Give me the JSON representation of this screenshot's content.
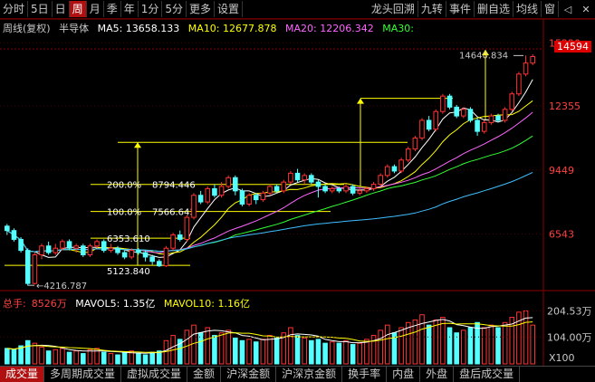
{
  "toolbar": {
    "items": [
      "分时",
      "5日",
      "日",
      "周",
      "月",
      "季",
      "年",
      "1分",
      "5分",
      "更多",
      "设置"
    ],
    "active": "周",
    "right_items": [
      "龙头回溯",
      "九转",
      "事件",
      "删自选",
      "均线",
      "窗"
    ]
  },
  "legend": {
    "title": "周线(复权)",
    "name": "半导体",
    "ma5": "MA5: 13658.133",
    "ma10": "MA10: 12677.878",
    "ma20": "MA20: 12206.342",
    "ma30": "MA30: ",
    "colors": {
      "ma5": "#ffffff",
      "ma10": "#ffff00",
      "ma20": "#ff66ff",
      "ma30": "#33ff33",
      "ma60": "#3fbfff"
    }
  },
  "price_axis": {
    "ticks": [
      "15220",
      "12355",
      "9449",
      "6543"
    ],
    "current": "14594"
  },
  "annotations": {
    "high": "14640.834",
    "low": "4216.787",
    "level200": "200.0%",
    "level200_val": "8794.446",
    "level100": "100.0%",
    "level100_val": "7566.643",
    "level_mid_val": "6353.610",
    "level_base_val": "5123.840"
  },
  "volume": {
    "label": "总手:",
    "value": "8526万",
    "mavol5": "MAVOL5: 1.35亿",
    "mavol10": "MAVOL10: 1.16亿",
    "axis_ticks": [
      "204.53万",
      "104.00万"
    ],
    "unit": "X100"
  },
  "bottom_tabs": [
    "成交量",
    "多周期成交量",
    "虚拟成交量",
    "金额",
    "沪深金额",
    "沪深京金额",
    "换手率",
    "内盘",
    "外盘",
    "盘后成交量"
  ],
  "bottom_active": "成交量",
  "chart_data": {
    "type": "candlestick",
    "y_range": [
      4100,
      15600
    ],
    "candles": [
      [
        6900,
        6700,
        7000,
        6500
      ],
      [
        6700,
        6300,
        6800,
        6200
      ],
      [
        6300,
        5800,
        6400,
        5700
      ],
      [
        5800,
        4300,
        5900,
        4200
      ],
      [
        4300,
        5600,
        5700,
        4250
      ],
      [
        5600,
        6000,
        6100,
        5400
      ],
      [
        6000,
        5700,
        6200,
        5600
      ],
      [
        5700,
        5900,
        6100,
        5600
      ],
      [
        5900,
        6200,
        6300,
        5800
      ],
      [
        6200,
        5900,
        6300,
        5800
      ],
      [
        5900,
        6000,
        6100,
        5700
      ],
      [
        6000,
        5600,
        6100,
        5500
      ],
      [
        5600,
        6000,
        6100,
        5500
      ],
      [
        6000,
        6200,
        6300,
        5900
      ],
      [
        6200,
        5800,
        6300,
        5700
      ],
      [
        5800,
        5900,
        6100,
        5700
      ],
      [
        5900,
        5700,
        6000,
        5600
      ],
      [
        5700,
        5500,
        5800,
        5400
      ],
      [
        5500,
        5800,
        5900,
        5400
      ],
      [
        5800,
        5700,
        5900,
        5600
      ],
      [
        5700,
        5500,
        5800,
        5300
      ],
      [
        5500,
        5300,
        5600,
        5150
      ],
      [
        5300,
        5100,
        5400,
        5050
      ],
      [
        5100,
        5900,
        6000,
        5050
      ],
      [
        5900,
        6500,
        6600,
        5800
      ],
      [
        6500,
        6300,
        6700,
        6200
      ],
      [
        6300,
        7300,
        7400,
        6200
      ],
      [
        7300,
        8300,
        8400,
        7200
      ],
      [
        8300,
        8000,
        8500,
        7900
      ],
      [
        8000,
        8600,
        8700,
        7900
      ],
      [
        8600,
        8300,
        8800,
        8200
      ],
      [
        8300,
        8700,
        8900,
        8200
      ],
      [
        8700,
        9100,
        9200,
        8600
      ],
      [
        9100,
        8500,
        9200,
        8300
      ],
      [
        8500,
        7900,
        8600,
        7800
      ],
      [
        7900,
        8300,
        8400,
        7800
      ],
      [
        8300,
        8100,
        8400,
        7900
      ],
      [
        8100,
        8400,
        8500,
        8000
      ],
      [
        8400,
        8700,
        8800,
        8300
      ],
      [
        8700,
        8500,
        8800,
        8400
      ],
      [
        8500,
        8900,
        9000,
        8400
      ],
      [
        8900,
        9300,
        9400,
        8800
      ],
      [
        9300,
        9000,
        9500,
        8900
      ],
      [
        9000,
        9200,
        9300,
        8800
      ],
      [
        9200,
        8900,
        9300,
        8800
      ],
      [
        8900,
        8700,
        9000,
        8200
      ],
      [
        8700,
        8500,
        8800,
        8400
      ],
      [
        8500,
        8600,
        8700,
        8400
      ],
      [
        8600,
        8500,
        8700,
        8400
      ],
      [
        8500,
        8700,
        8800,
        8400
      ],
      [
        8700,
        8400,
        8800,
        8300
      ],
      [
        8400,
        8500,
        8600,
        8300
      ],
      [
        8500,
        8600,
        8700,
        8400
      ],
      [
        8600,
        8800,
        8900,
        8500
      ],
      [
        8800,
        9200,
        9300,
        8700
      ],
      [
        9200,
        9600,
        9700,
        9100
      ],
      [
        9600,
        9400,
        9700,
        9300
      ],
      [
        9400,
        9900,
        10000,
        9300
      ],
      [
        9900,
        10400,
        10500,
        9800
      ],
      [
        10400,
        10900,
        11000,
        10300
      ],
      [
        10900,
        11700,
        11800,
        10800
      ],
      [
        11700,
        11300,
        11900,
        11200
      ],
      [
        11300,
        12100,
        12200,
        11200
      ],
      [
        12100,
        12800,
        12900,
        12000
      ],
      [
        12800,
        12300,
        12900,
        12200
      ],
      [
        12300,
        11900,
        12400,
        11800
      ],
      [
        11900,
        12200,
        12300,
        11800
      ],
      [
        12200,
        11700,
        12300,
        11600
      ],
      [
        11700,
        11200,
        11800,
        11000
      ],
      [
        11200,
        11600,
        11700,
        11100
      ],
      [
        11600,
        11900,
        12000,
        11500
      ],
      [
        11900,
        11700,
        12000,
        11600
      ],
      [
        11700,
        12200,
        12300,
        11600
      ],
      [
        12200,
        12900,
        13000,
        12100
      ],
      [
        12900,
        13800,
        13900,
        12800
      ],
      [
        13800,
        14300,
        14640,
        13700
      ],
      [
        14300,
        14594,
        14700,
        14200
      ]
    ],
    "volumes": [
      60,
      55,
      70,
      90,
      80,
      65,
      50,
      55,
      60,
      45,
      50,
      40,
      55,
      60,
      45,
      40,
      35,
      45,
      50,
      40,
      35,
      45,
      50,
      90,
      110,
      95,
      130,
      150,
      120,
      140,
      110,
      120,
      130,
      100,
      90,
      95,
      85,
      95,
      110,
      100,
      120,
      140,
      110,
      100,
      90,
      95,
      80,
      85,
      80,
      90,
      75,
      80,
      95,
      110,
      130,
      150,
      120,
      140,
      160,
      170,
      190,
      150,
      170,
      180,
      140,
      120,
      130,
      140,
      160,
      140,
      150,
      140,
      160,
      180,
      200,
      205,
      150
    ]
  }
}
